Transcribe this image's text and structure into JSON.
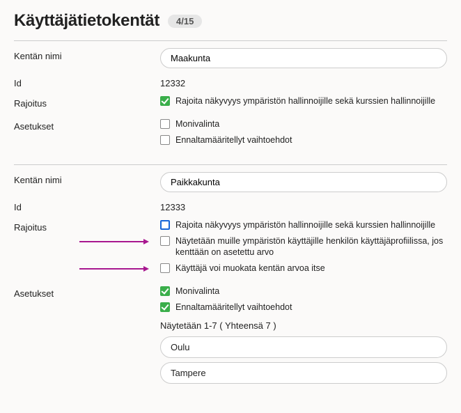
{
  "header": {
    "title": "Käyttäjätietokentät",
    "counter": "4/15"
  },
  "labels": {
    "field_name": "Kentän nimi",
    "id": "Id",
    "restriction": "Rajoitus",
    "settings": "Asetukset"
  },
  "field1": {
    "name": "Maakunta",
    "id": "12332",
    "restrict_visibility": "Rajoita näkyvyys ympäristön hallinnoijille sekä kurssien hallinnoijille",
    "multiselect": "Monivalinta",
    "predefined": "Ennaltamääritellyt vaihtoehdot"
  },
  "field2": {
    "name": "Paikkakunta",
    "id": "12333",
    "restrict_visibility": "Rajoita näkyvyys ympäristön hallinnoijille sekä kurssien hallinnoijille",
    "show_others": "Näytetään muille ympäristön käyttäjille henkilön käyttäjäprofiilissa, jos kenttään on asetettu arvo",
    "user_can_edit": "Käyttäjä voi muokata kentän arvoa itse",
    "multiselect": "Monivalinta",
    "predefined": "Ennaltamääritellyt vaihtoehdot",
    "options_summary": "Näytetään 1-7 ( Yhteensä 7 )",
    "options": [
      "Oulu",
      "Tampere"
    ]
  }
}
